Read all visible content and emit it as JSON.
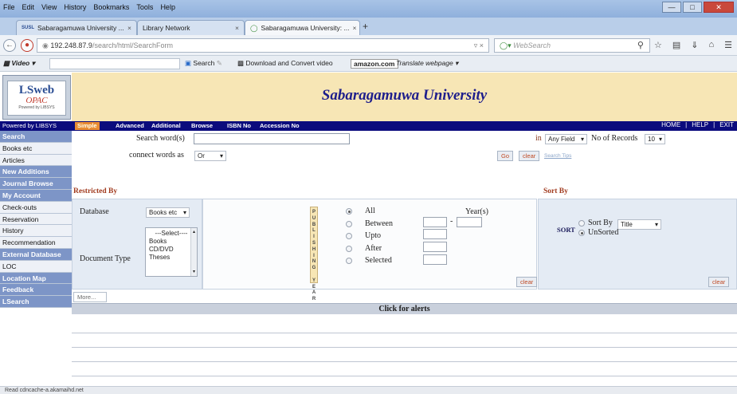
{
  "browser": {
    "menu": [
      "File",
      "Edit",
      "View",
      "History",
      "Bookmarks",
      "Tools",
      "Help"
    ],
    "tabs": [
      {
        "label": "Sabaragamuwa University ..."
      },
      {
        "label": "Library Network"
      },
      {
        "label": "Sabaragamuwa University: ..."
      }
    ],
    "new_tab": "+",
    "url_host": "192.248.87.9",
    "url_path": "/search/html/SearchForm",
    "search_placeholder": "WebSearch",
    "toolbar": {
      "video": "Video",
      "search": "Search",
      "download": "Download and Convert video",
      "amazon": "amazon.com",
      "translate": "Translate webpage"
    },
    "status": "Read cdncache-a.akamaihd.net"
  },
  "site": {
    "logo_main": "LSweb",
    "logo_sub": "OPAC",
    "logo_powered": "Powered by LIBSYS",
    "title": "Sabaragamuwa University",
    "powered_by": "Powered by LIBSYS"
  },
  "nav_tabs": [
    "Simple",
    "Advanced",
    "Additional",
    "Browse",
    "ISBN No",
    "Accession No"
  ],
  "top_links": [
    "HOME",
    "HELP",
    "EXIT"
  ],
  "sidebar": [
    {
      "label": "Search",
      "type": "head"
    },
    {
      "label": "Books etc",
      "type": "light"
    },
    {
      "label": "Articles",
      "type": "light"
    },
    {
      "label": "New Additions",
      "type": "head"
    },
    {
      "label": "Journal Browse",
      "type": "head"
    },
    {
      "label": "My Account",
      "type": "head"
    },
    {
      "label": "Check-outs",
      "type": "light"
    },
    {
      "label": "Reservation",
      "type": "light"
    },
    {
      "label": "History",
      "type": "light"
    },
    {
      "label": "Recommendation",
      "type": "light"
    },
    {
      "label": "External Database",
      "type": "head"
    },
    {
      "label": "LOC",
      "type": "light"
    },
    {
      "label": "Location Map",
      "type": "head"
    },
    {
      "label": "Feedback",
      "type": "head"
    },
    {
      "label": "LSearch",
      "type": "head"
    }
  ],
  "search": {
    "search_words_label": "Search word(s)",
    "search_words_value": "",
    "connect_label": "connect words as",
    "connect_value": "Or",
    "in_label": "in",
    "in_value": "Any Field",
    "records_label": "No of Records",
    "records_value": "10",
    "go": "Go",
    "clear": "clear",
    "tips": "Search Tips"
  },
  "restricted": {
    "heading": "Restricted By",
    "database_label": "Database",
    "database_value": "Books etc",
    "doctype_label": "Document Type",
    "doctype_options": [
      "---Select----",
      "Books",
      "CD/DVD",
      "Theses"
    ],
    "pub_year_vertical": "PUBLISHING YEAR",
    "year_label": "Year(s)",
    "year_options": [
      "All",
      "Between",
      "Upto",
      "After",
      "Selected"
    ],
    "year_selected": "All",
    "between_sep": "-",
    "clear": "clear"
  },
  "sort": {
    "heading": "Sort By",
    "sort_label": "SORT",
    "sort_by_label": "Sort By",
    "sort_by_value": "Title",
    "unsorted_label": "UnSorted",
    "selected": "UnSorted",
    "clear": "clear"
  },
  "more": "More...",
  "alerts": "Click for alerts"
}
